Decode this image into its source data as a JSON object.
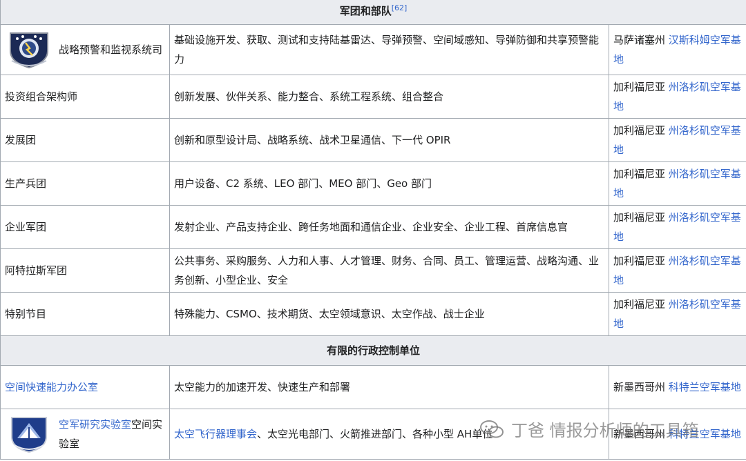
{
  "section1": {
    "title": "军团和部队",
    "ref": "[62]"
  },
  "section2": {
    "title": "有限的行政控制单位"
  },
  "rows": [
    {
      "unit": "战略预警和监视系统司",
      "mission": "基础设施开发、获取、测试和支持陆基雷达、导弹预警、空间域感知、导弹防御和共享预警能力",
      "loc_prefix": "马萨诸塞州 ",
      "loc_link": "汉斯科姆空军基地"
    },
    {
      "unit": "投资组合架构师",
      "mission": "创新发展、伙伴关系、能力整合、系统工程系统、组合整合",
      "loc_prefix": "加利福尼亚 ",
      "loc_link": "州洛杉矶空军基地"
    },
    {
      "unit": "发展团",
      "mission": "创新和原型设计局、战略系统、战术卫星通信、下一代 OPIR",
      "loc_prefix": "加利福尼亚 ",
      "loc_link": "州洛杉矶空军基地"
    },
    {
      "unit": "生产兵团",
      "mission": "用户设备、C2 系统、LEO 部门、MEO 部门、Geo 部门",
      "loc_prefix": "加利福尼亚 ",
      "loc_link": "州洛杉矶空军基地"
    },
    {
      "unit": "企业军团",
      "mission": "发射企业、产品支持企业、跨任务地面和通信企业、企业安全、企业工程、首席信息官",
      "loc_prefix": "加利福尼亚 ",
      "loc_link": "州洛杉矶空军基地"
    },
    {
      "unit": "阿特拉斯军团",
      "mission": "公共事务、采购服务、人力和人事、人才管理、财务、合同、员工、管理运营、战略沟通、业务创新、小型企业、安全",
      "loc_prefix": "加利福尼亚 ",
      "loc_link": "州洛杉矶空军基地"
    },
    {
      "unit": "特别节目",
      "mission": "特殊能力、CSMO、技术期货、太空领域意识、太空作战、战士企业",
      "loc_prefix": "加利福尼亚 ",
      "loc_link": "州洛杉矶空军基地"
    }
  ],
  "rows2": [
    {
      "unit_link": "空间快速能力办公室",
      "mission": "太空能力的加速开发、快速生产和部署",
      "loc_prefix": "新墨西哥州 ",
      "loc_link": "科特兰空军基地"
    },
    {
      "unit_link": "空军研究实验室",
      "unit_suffix": "空间实验室",
      "mission_link": "太空飞行器理事会",
      "mission_rest": "、太空光电部门、火箭推进部门、各种小型 AH",
      "mission_tail": "单位",
      "loc_prefix": "新墨西哥州 ",
      "loc_link": "科特兰空军基地"
    }
  ],
  "watermark": "丁爸 情报分析师的工具箱"
}
